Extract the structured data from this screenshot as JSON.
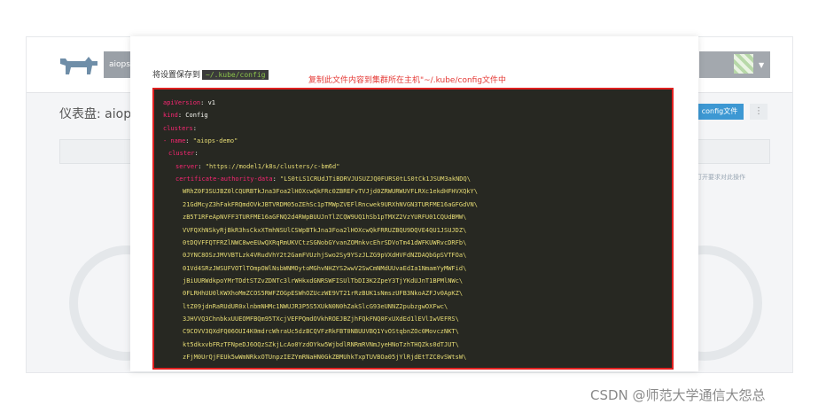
{
  "background": {
    "env_label": "aiops",
    "dashboard_title": "仪表盘: aiops",
    "config_button": "config文件",
    "more_button": "⋮",
    "side_link": "打开要求对此操作"
  },
  "modal": {
    "save_prefix": "将设置保存到",
    "save_path": "~/.kube/config",
    "annotation": "复制此文件内容到集群所在主机\"~/.kube/config文件中",
    "yaml": [
      {
        "indent": 0,
        "key": "apiVersion",
        "val": "v1",
        "type": "plain"
      },
      {
        "indent": 0,
        "key": "kind",
        "val": "Config",
        "type": "plain"
      },
      {
        "indent": 0,
        "key": "clusters",
        "val": "",
        "type": "plain"
      },
      {
        "indent": 0,
        "key": "- name",
        "val": "\"aiops-demo\"",
        "type": "str"
      },
      {
        "indent": 1,
        "key": "cluster",
        "val": "",
        "type": "plain"
      },
      {
        "indent": 2,
        "key": "server",
        "val": "\"https://model1/k8s/clusters/c-bm6d\"",
        "type": "str"
      },
      {
        "indent": 2,
        "key": "certificate-authority-data",
        "val": "\"LS0tLS1CRUdJTiBDRVJUSUZJQ0FURS0tLS0tCk1JSUM3akNDQ\\",
        "type": "str"
      },
      {
        "indent": 3,
        "key": "",
        "val": "WRhZ0F3SUJBZ0lCQURBTkJna3Foa2lHOXcwQkFRc0ZBREFvTVJjd0ZRWURWUVFLRXc1ekdHFHVXQkY\\",
        "type": "str"
      },
      {
        "indent": 3,
        "key": "",
        "val": "21GdMcyZ3hFakFRQmdOVkJBTVRDM05oZEhSc1pTMWpZVEFlRncwek9URXhNVGN3TURFME16aGFGdVN\\",
        "type": "str"
      },
      {
        "indent": 3,
        "key": "",
        "val": "zB5T1RFeApNVFF3TURFME16aGFNQ2d4RWpBUUJnTlZCQW9UQ1hSb1pTMXZ2VzYURFU01CQUdBMW\\",
        "type": "str"
      },
      {
        "indent": 3,
        "key": "",
        "val": "VVFQXhNSkyRjBkR3hsCkxXTmhNSUlCSWpBTkJna3Foa2lHOXcwQkFRRUZBQU9DQVE4QU1JSUJDZ\\",
        "type": "str"
      },
      {
        "indent": 3,
        "key": "",
        "val": "0tDQVFFQTFRZlNWC8weEUwQXRqRmUKVCtzSGNobGYvanZOMnkvcEhrSDVoTm41dWFKUWRvcDRFb\\",
        "type": "str"
      },
      {
        "indent": 3,
        "key": "",
        "val": "0JYNC8OSzJMVVBTLzk4VRudVhY2t2GamFVUzhjSwo2Sy9YSzJLZG9pVXdHVFdNZDAQbGpSVTFOa\\",
        "type": "str"
      },
      {
        "indent": 3,
        "key": "",
        "val": "01Vd4SRzJWSUFVOTlTOmpOWlNsbWNMOytoMGhvNHZYS2wwV2SwCmNMdUUvaEdIa1NmamYyMWFid\\",
        "type": "str"
      },
      {
        "indent": 3,
        "key": "",
        "val": "jBiUURWdkpoYMrTDdtSTZvZDNTc3lrWHkxdGNRSWFISUlTbDI3K2ZpeY3TjYKdUJnT1BPMlNWc\\",
        "type": "str"
      },
      {
        "indent": 3,
        "key": "",
        "val": "0FLRHhUU0lKWXhoMmZCOS5RWFZOGpESWhOZUczWE9VT21rRzBUK1sNmszUFB3NkoAZFJv0ApKZ\\",
        "type": "str"
      },
      {
        "indent": 3,
        "key": "",
        "val": "ltZ09jdnRaRUdUR0xlnbmNHMc1NWUJR3P5S5XUkN0N0hZakSlcG93eUNNZ2pubzgwOXFwc\\",
        "type": "str"
      },
      {
        "indent": 3,
        "key": "",
        "val": "3JHVVQ3ChnbkxUUEOMFBQm95TXcjVEFPQmdOVkhROEJBZjhFQkFNQ0FxUXdEd1lEVlIwVEFRS\\",
        "type": "str"
      },
      {
        "indent": 3,
        "key": "",
        "val": "C9COVV3QXdFQ06OUI4K0mdrcWhraUc5dzBCQVFzRkFBT0NBUUVBQ1YvOStqbnZOc0MovczNKT\\",
        "type": "str"
      },
      {
        "indent": 3,
        "key": "",
        "val": "kt5dkxvbFRzTFNpeDJ6OQzSZkjLcAo0YzdOYkw5WjbdlRNRmRVNmJyeHNoTzhTHQZks0dTJUT\\",
        "type": "str"
      },
      {
        "indent": 3,
        "key": "",
        "val": "zFjM0UrQjFEUk5wWmNRkxOTUnpzIEZYmRNaHN0GkZBMUhkTxpTUVBOa05jYlRjdEtTZC8vSWtsW\\",
        "type": "str"
      }
    ]
  },
  "watermark": "CSDN @师范大学通信大怨总"
}
